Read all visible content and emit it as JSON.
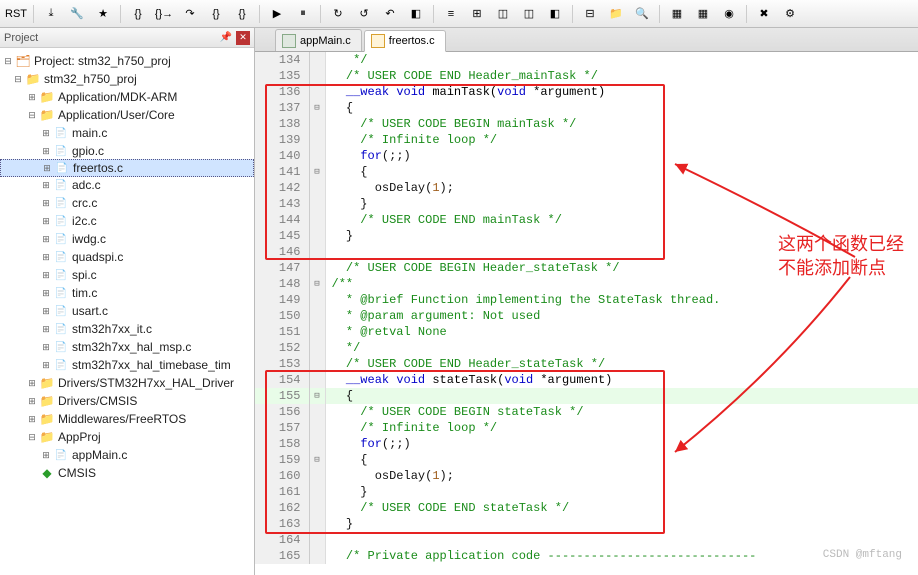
{
  "toolbar": {
    "buttons": [
      "RST",
      "⤓",
      "🔧",
      "★",
      "{}",
      "{}→",
      "↷",
      "{}",
      "{}",
      "▶",
      "⏸",
      "↻",
      "↺",
      "↶",
      "◧",
      "≡",
      "⊞",
      "◫",
      "◫",
      "◧",
      "⊟",
      "📁",
      "🔍",
      "▦",
      "▦",
      "◉",
      "✖",
      "⚙"
    ]
  },
  "project_panel": {
    "title": "Project",
    "root": "Project: stm32_h750_proj",
    "nodes": [
      {
        "indent": 1,
        "exp": "⊟",
        "icon": "📁",
        "cls": "folder-icon",
        "label": "stm32_h750_proj"
      },
      {
        "indent": 2,
        "exp": "⊞",
        "icon": "📁",
        "cls": "folder-icon",
        "label": "Application/MDK-ARM"
      },
      {
        "indent": 2,
        "exp": "⊟",
        "icon": "📁",
        "cls": "folder-icon",
        "label": "Application/User/Core"
      },
      {
        "indent": 3,
        "exp": "⊞",
        "icon": "📄",
        "cls": "file-icon",
        "label": "main.c"
      },
      {
        "indent": 3,
        "exp": "⊞",
        "icon": "📄",
        "cls": "file-icon",
        "label": "gpio.c"
      },
      {
        "indent": 3,
        "exp": "⊞",
        "icon": "📄",
        "cls": "file-icon",
        "label": "freertos.c",
        "selected": true
      },
      {
        "indent": 3,
        "exp": "⊞",
        "icon": "📄",
        "cls": "file-icon",
        "label": "adc.c"
      },
      {
        "indent": 3,
        "exp": "⊞",
        "icon": "📄",
        "cls": "file-icon",
        "label": "crc.c"
      },
      {
        "indent": 3,
        "exp": "⊞",
        "icon": "📄",
        "cls": "file-icon",
        "label": "i2c.c"
      },
      {
        "indent": 3,
        "exp": "⊞",
        "icon": "📄",
        "cls": "file-icon",
        "label": "iwdg.c"
      },
      {
        "indent": 3,
        "exp": "⊞",
        "icon": "📄",
        "cls": "file-icon",
        "label": "quadspi.c"
      },
      {
        "indent": 3,
        "exp": "⊞",
        "icon": "📄",
        "cls": "file-icon",
        "label": "spi.c"
      },
      {
        "indent": 3,
        "exp": "⊞",
        "icon": "📄",
        "cls": "file-icon",
        "label": "tim.c"
      },
      {
        "indent": 3,
        "exp": "⊞",
        "icon": "📄",
        "cls": "file-icon",
        "label": "usart.c"
      },
      {
        "indent": 3,
        "exp": "⊞",
        "icon": "📄",
        "cls": "file-icon",
        "label": "stm32h7xx_it.c"
      },
      {
        "indent": 3,
        "exp": "⊞",
        "icon": "📄",
        "cls": "file-icon",
        "label": "stm32h7xx_hal_msp.c"
      },
      {
        "indent": 3,
        "exp": "⊞",
        "icon": "📄",
        "cls": "file-icon",
        "label": "stm32h7xx_hal_timebase_tim"
      },
      {
        "indent": 2,
        "exp": "⊞",
        "icon": "📁",
        "cls": "folder-icon",
        "label": "Drivers/STM32H7xx_HAL_Driver"
      },
      {
        "indent": 2,
        "exp": "⊞",
        "icon": "📁",
        "cls": "folder-icon",
        "label": "Drivers/CMSIS"
      },
      {
        "indent": 2,
        "exp": "⊞",
        "icon": "📁",
        "cls": "folder-icon",
        "label": "Middlewares/FreeRTOS"
      },
      {
        "indent": 2,
        "exp": "⊟",
        "icon": "📁",
        "cls": "folder-icon",
        "label": "AppProj"
      },
      {
        "indent": 3,
        "exp": "⊞",
        "icon": "📄",
        "cls": "file-icon",
        "label": "appMain.c"
      },
      {
        "indent": 2,
        "exp": "",
        "icon": "◆",
        "cls": "diamond-icon",
        "label": "CMSIS"
      }
    ]
  },
  "editor": {
    "tabs": [
      {
        "label": "appMain.c",
        "active": false
      },
      {
        "label": "freertos.c",
        "active": true
      }
    ],
    "lines": [
      {
        "n": 134,
        "fold": "",
        "tokens": [
          {
            "t": "   */",
            "c": "comment"
          }
        ]
      },
      {
        "n": 135,
        "fold": "",
        "tokens": [
          {
            "t": "  /* USER CODE END Header_mainTask */",
            "c": "comment"
          }
        ]
      },
      {
        "n": 136,
        "fold": "",
        "tokens": [
          {
            "t": "  __weak ",
            "c": "keyword"
          },
          {
            "t": "void",
            "c": "keyword"
          },
          {
            "t": " mainTask(",
            "c": "func"
          },
          {
            "t": "void",
            "c": "keyword"
          },
          {
            "t": " *argument)",
            "c": "func"
          }
        ]
      },
      {
        "n": 137,
        "fold": "⊟",
        "tokens": [
          {
            "t": "  {",
            "c": ""
          }
        ]
      },
      {
        "n": 138,
        "fold": "",
        "tokens": [
          {
            "t": "    /* USER CODE BEGIN mainTask */",
            "c": "comment"
          }
        ]
      },
      {
        "n": 139,
        "fold": "",
        "tokens": [
          {
            "t": "    /* Infinite loop */",
            "c": "comment"
          }
        ]
      },
      {
        "n": 140,
        "fold": "",
        "tokens": [
          {
            "t": "    ",
            "c": ""
          },
          {
            "t": "for",
            "c": "keyword"
          },
          {
            "t": "(;;)",
            "c": ""
          }
        ]
      },
      {
        "n": 141,
        "fold": "⊟",
        "tokens": [
          {
            "t": "    {",
            "c": ""
          }
        ]
      },
      {
        "n": 142,
        "fold": "",
        "tokens": [
          {
            "t": "      osDelay(",
            "c": ""
          },
          {
            "t": "1",
            "c": "num"
          },
          {
            "t": ");",
            "c": ""
          }
        ]
      },
      {
        "n": 143,
        "fold": "",
        "tokens": [
          {
            "t": "    }",
            "c": ""
          }
        ]
      },
      {
        "n": 144,
        "fold": "",
        "tokens": [
          {
            "t": "    /* USER CODE END mainTask */",
            "c": "comment"
          }
        ]
      },
      {
        "n": 145,
        "fold": "",
        "tokens": [
          {
            "t": "  }",
            "c": ""
          }
        ]
      },
      {
        "n": 146,
        "fold": "",
        "tokens": [
          {
            "t": "",
            "c": ""
          }
        ]
      },
      {
        "n": 147,
        "fold": "",
        "tokens": [
          {
            "t": "  /* USER CODE BEGIN Header_stateTask */",
            "c": "comment"
          }
        ]
      },
      {
        "n": 148,
        "fold": "⊟",
        "tokens": [
          {
            "t": "/**",
            "c": "comment"
          }
        ]
      },
      {
        "n": 149,
        "fold": "",
        "tokens": [
          {
            "t": "  * @brief Function implementing the StateTask thread.",
            "c": "comment"
          }
        ]
      },
      {
        "n": 150,
        "fold": "",
        "tokens": [
          {
            "t": "  * @param argument: Not used",
            "c": "comment"
          }
        ]
      },
      {
        "n": 151,
        "fold": "",
        "tokens": [
          {
            "t": "  * @retval None",
            "c": "comment"
          }
        ]
      },
      {
        "n": 152,
        "fold": "",
        "tokens": [
          {
            "t": "  */",
            "c": "comment"
          }
        ]
      },
      {
        "n": 153,
        "fold": "",
        "tokens": [
          {
            "t": "  /* USER CODE END Header_stateTask */",
            "c": "comment"
          }
        ]
      },
      {
        "n": 154,
        "fold": "",
        "tokens": [
          {
            "t": "  __weak ",
            "c": "keyword"
          },
          {
            "t": "void",
            "c": "keyword"
          },
          {
            "t": " stateTask(",
            "c": "func"
          },
          {
            "t": "void",
            "c": "keyword"
          },
          {
            "t": " *argument)",
            "c": "func"
          }
        ]
      },
      {
        "n": 155,
        "fold": "⊟",
        "hl": true,
        "tokens": [
          {
            "t": "  {",
            "c": ""
          }
        ]
      },
      {
        "n": 156,
        "fold": "",
        "tokens": [
          {
            "t": "    /* USER CODE BEGIN stateTask */",
            "c": "comment"
          }
        ]
      },
      {
        "n": 157,
        "fold": "",
        "tokens": [
          {
            "t": "    /* Infinite loop */",
            "c": "comment"
          }
        ]
      },
      {
        "n": 158,
        "fold": "",
        "tokens": [
          {
            "t": "    ",
            "c": ""
          },
          {
            "t": "for",
            "c": "keyword"
          },
          {
            "t": "(;;)",
            "c": ""
          }
        ]
      },
      {
        "n": 159,
        "fold": "⊟",
        "tokens": [
          {
            "t": "    {",
            "c": ""
          }
        ]
      },
      {
        "n": 160,
        "fold": "",
        "tokens": [
          {
            "t": "      osDelay(",
            "c": ""
          },
          {
            "t": "1",
            "c": "num"
          },
          {
            "t": ");",
            "c": ""
          }
        ]
      },
      {
        "n": 161,
        "fold": "",
        "tokens": [
          {
            "t": "    }",
            "c": ""
          }
        ]
      },
      {
        "n": 162,
        "fold": "",
        "tokens": [
          {
            "t": "    /* USER CODE END stateTask */",
            "c": "comment"
          }
        ]
      },
      {
        "n": 163,
        "fold": "",
        "tokens": [
          {
            "t": "  }",
            "c": ""
          }
        ]
      },
      {
        "n": 164,
        "fold": "",
        "tokens": [
          {
            "t": "",
            "c": ""
          }
        ]
      },
      {
        "n": 165,
        "fold": "",
        "tokens": [
          {
            "t": "  /* Private application code -----------------------------",
            "c": "comment"
          }
        ]
      }
    ]
  },
  "annotation": {
    "line1": "这两个函数已经",
    "line2": "不能添加断点"
  },
  "watermark": "CSDN @mftang"
}
